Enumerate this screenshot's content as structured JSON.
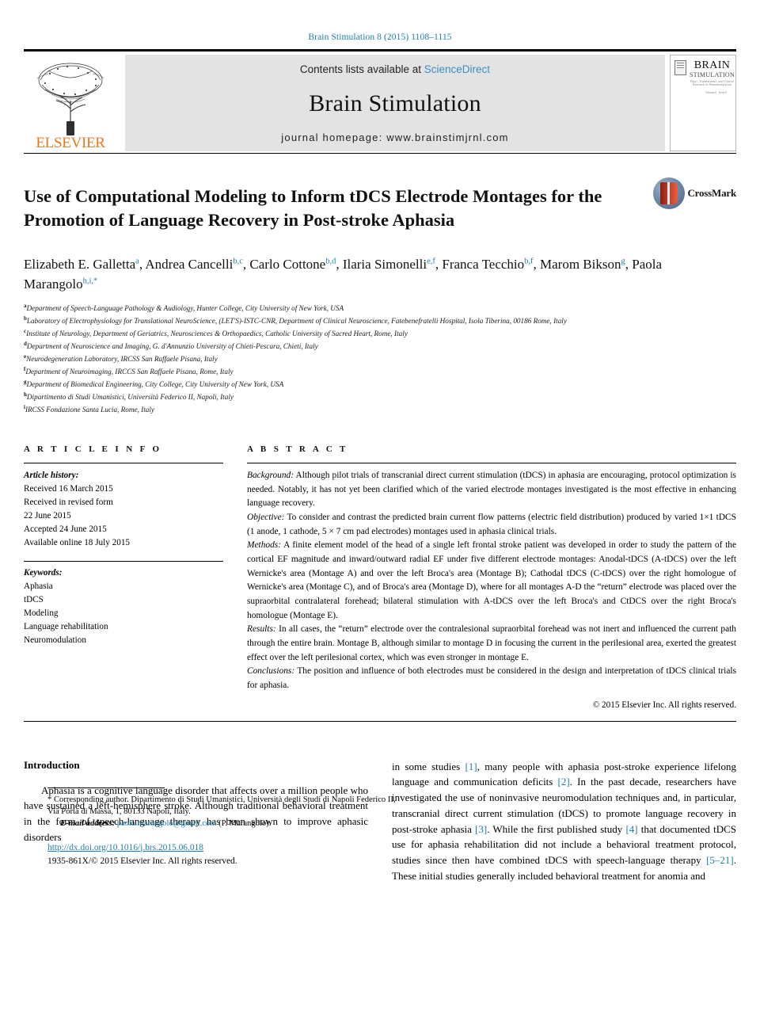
{
  "running_head": "Brain Stimulation 8 (2015) 1108–1115",
  "masthead": {
    "publisher": "ELSEVIER",
    "contents_prefix": "Contents lists available at",
    "contents_link": "ScienceDirect",
    "journal_name": "Brain Stimulation",
    "homepage": "journal homepage: www.brainstimjrnl.com",
    "cover": {
      "title_line1": "BRAIN",
      "title_line2": "STIMULATION",
      "subtitle": "Basic, Translational, and Clinical Research in Neuromodulation",
      "issue_note": "Volume 8 · Issue 6"
    }
  },
  "article": {
    "title": "Use of Computational Modeling to Inform tDCS Electrode Montages for the Promotion of Language Recovery in Post-stroke Aphasia",
    "crossmark_label": "CrossMark",
    "authors": [
      {
        "name": "Elizabeth E. Galletta",
        "marks": "a",
        "sep": ", "
      },
      {
        "name": "Andrea Cancelli",
        "marks": "b,c",
        "sep": ", "
      },
      {
        "name": "Carlo Cottone",
        "marks": "b,d",
        "sep": ", "
      },
      {
        "name": "Ilaria Simonelli",
        "marks": "e,f",
        "sep": ", "
      },
      {
        "name": "Franca Tecchio",
        "marks": "b,f",
        "sep": ", "
      },
      {
        "name": "Marom Bikson",
        "marks": "g",
        "sep": ", "
      },
      {
        "name": "Paola Marangolo",
        "marks": "h,i,*",
        "sep": ""
      }
    ],
    "affiliations": [
      {
        "mark": "a",
        "text": "Department of Speech-Language Pathology & Audiology, Hunter College, City University of New York, USA"
      },
      {
        "mark": "b",
        "text": "Laboratory of Electrophysiology for Translational NeuroScience, (LET'S)-ISTC-CNR, Department of Clinical Neuroscience, Fatebenefratelli Hospital, Isola Tiberina, 00186 Rome, Italy"
      },
      {
        "mark": "c",
        "text": "Institute of Neurology, Department of Geriatrics, Neurosciences & Orthopaedics, Catholic University of Sacred Heart, Rome, Italy"
      },
      {
        "mark": "d",
        "text": "Department of Neuroscience and Imaging, G. d'Annunzio University of Chieti-Pescara, Chieti, Italy"
      },
      {
        "mark": "e",
        "text": "Neurodegeneration Laboratory, IRCSS San Raffaele Pisana, Italy"
      },
      {
        "mark": "f",
        "text": "Department of Neuroimaging, IRCCS San Raffaele Pisana, Rome, Italy"
      },
      {
        "mark": "g",
        "text": "Department of Biomedical Engineering, City College, City University of New York, USA"
      },
      {
        "mark": "h",
        "text": "Dipartimento di Studi Umanistici, Università Federico II, Napoli, Italy"
      },
      {
        "mark": "i",
        "text": "IRCSS Fondazione Santa Lucia, Rome, Italy"
      }
    ]
  },
  "article_info": {
    "heading": "A R T I C L E   I N F O",
    "history_label": "Article history:",
    "history": [
      "Received 16 March 2015",
      "Received in revised form",
      "22 June 2015",
      "Accepted 24 June 2015",
      "Available online 18 July 2015"
    ],
    "keywords_label": "Keywords:",
    "keywords": [
      "Aphasia",
      "tDCS",
      "Modeling",
      "Language rehabilitation",
      "Neuromodulation"
    ]
  },
  "abstract": {
    "heading": "A B S T R A C T",
    "sections": [
      {
        "label": "Background:",
        "text": " Although pilot trials of transcranial direct current stimulation (tDCS) in aphasia are encouraging, protocol optimization is needed. Notably, it has not yet been clarified which of the varied electrode montages investigated is the most effective in enhancing language recovery."
      },
      {
        "label": "Objective:",
        "text": " To consider and contrast the predicted brain current flow patterns (electric field distribution) produced by varied 1×1 tDCS (1 anode, 1 cathode, 5 × 7 cm pad electrodes) montages used in aphasia clinical trials."
      },
      {
        "label": "Methods:",
        "text": " A finite element model of the head of a single left frontal stroke patient was developed in order to study the pattern of the cortical EF magnitude and inward/outward radial EF under five different electrode montages: Anodal-tDCS (A-tDCS) over the left Wernicke's area (Montage A) and over the left Broca's area (Montage B); Cathodal tDCS (C-tDCS) over the right homologue of Wernicke's area (Montage C), and of Broca's area (Montage D), where for all montages A-D the “return” electrode was placed over the supraorbital contralateral forehead; bilateral stimulation with A-tDCS over the left Broca's and CtDCS over the right Broca's homologue (Montage E)."
      },
      {
        "label": "Results:",
        "text": " In all cases, the “return” electrode over the contralesional supraorbital forehead was not inert and influenced the current path through the entire brain. Montage B, although similar to montage D in focusing the current in the perilesional area, exerted the greatest effect over the left perilesional cortex, which was even stronger in montage E."
      },
      {
        "label": "Conclusions:",
        "text": " The position and influence of both electrodes must be considered in the design and interpretation of tDCS clinical trials for aphasia."
      }
    ],
    "copyright": "© 2015 Elsevier Inc. All rights reserved."
  },
  "body": {
    "heading": "Introduction",
    "left_paragraph": "Aphasia is a cognitive language disorder that affects over a million people who have sustained a left-hemisphere stroke. Although traditional behavioral treatment in the form of speech-language therapy has been shown to improve aphasic disorders",
    "right_parts": [
      {
        "type": "text",
        "value": "in some studies "
      },
      {
        "type": "ref",
        "value": "[1]"
      },
      {
        "type": "text",
        "value": ", many people with aphasia post-stroke experience lifelong language and communication deficits "
      },
      {
        "type": "ref",
        "value": "[2]"
      },
      {
        "type": "text",
        "value": ". In the past decade, researchers have investigated the use of noninvasive neuromodulation techniques and, in particular, transcranial direct current stimulation (tDCS) to promote language recovery in post-stroke aphasia "
      },
      {
        "type": "ref",
        "value": "[3]"
      },
      {
        "type": "text",
        "value": ". While the first published study "
      },
      {
        "type": "ref",
        "value": "[4]"
      },
      {
        "type": "text",
        "value": " that documented tDCS use for aphasia rehabilitation did not include a behavioral treatment protocol, studies since then have combined tDCS with speech-language therapy "
      },
      {
        "type": "ref",
        "value": "[5–21]"
      },
      {
        "type": "text",
        "value": ". These initial studies generally included behavioral treatment for anomia and"
      }
    ]
  },
  "footer": {
    "corresponding_marker": "*",
    "corresponding_text": "Corresponding author. Dipartimento di Studi Umanistici, Università degli Studi di Napoli Federico II, Via Porta di Massa, 1, 80133 Napoli, Italy.",
    "email_label": "E-mail address:",
    "email": "paola.marangolo@gmail.com",
    "email_suffix": "(P. Marangolo).",
    "doi": "http://dx.doi.org/10.1016/j.brs.2015.06.018",
    "issn_line": "1935-861X/© 2015 Elsevier Inc. All rights reserved."
  },
  "colors": {
    "link": "#1a7fa8",
    "elsevier_orange": "#e87722",
    "band_gray": "#e3e3e3"
  }
}
